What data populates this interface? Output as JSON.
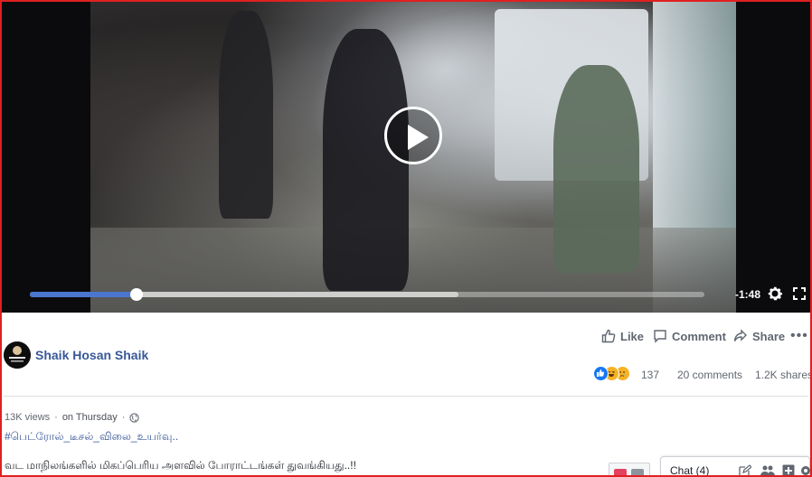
{
  "video": {
    "time_remaining": "-1:48",
    "progress_played_fraction": 0.158,
    "progress_buffered_fraction": 0.635
  },
  "post": {
    "author": "Shaik Hosan Shaik",
    "actions": {
      "like": "Like",
      "comment": "Comment",
      "share": "Share",
      "more": "•••"
    },
    "reactions": {
      "count": "137",
      "types": [
        "like-reaction-icon",
        "haha-reaction-icon",
        "sad-reaction-icon"
      ]
    },
    "comments": "20 comments",
    "shares": "1.2K shares",
    "views": "13K views",
    "separator": "·",
    "time": "on Thursday",
    "hashtag": "#பெட்ரோல்_டீசல்_விலை_உயர்வு..",
    "text": "வட மாநிலங்களில் மிகப்பெரிய அளவில் போராட்டங்கள் துவங்கியது..!!"
  },
  "chat": {
    "label": "Chat (4)"
  },
  "colors": {
    "link": "#385898",
    "progress": "#4a76d0",
    "frame_border": "#e02020"
  }
}
